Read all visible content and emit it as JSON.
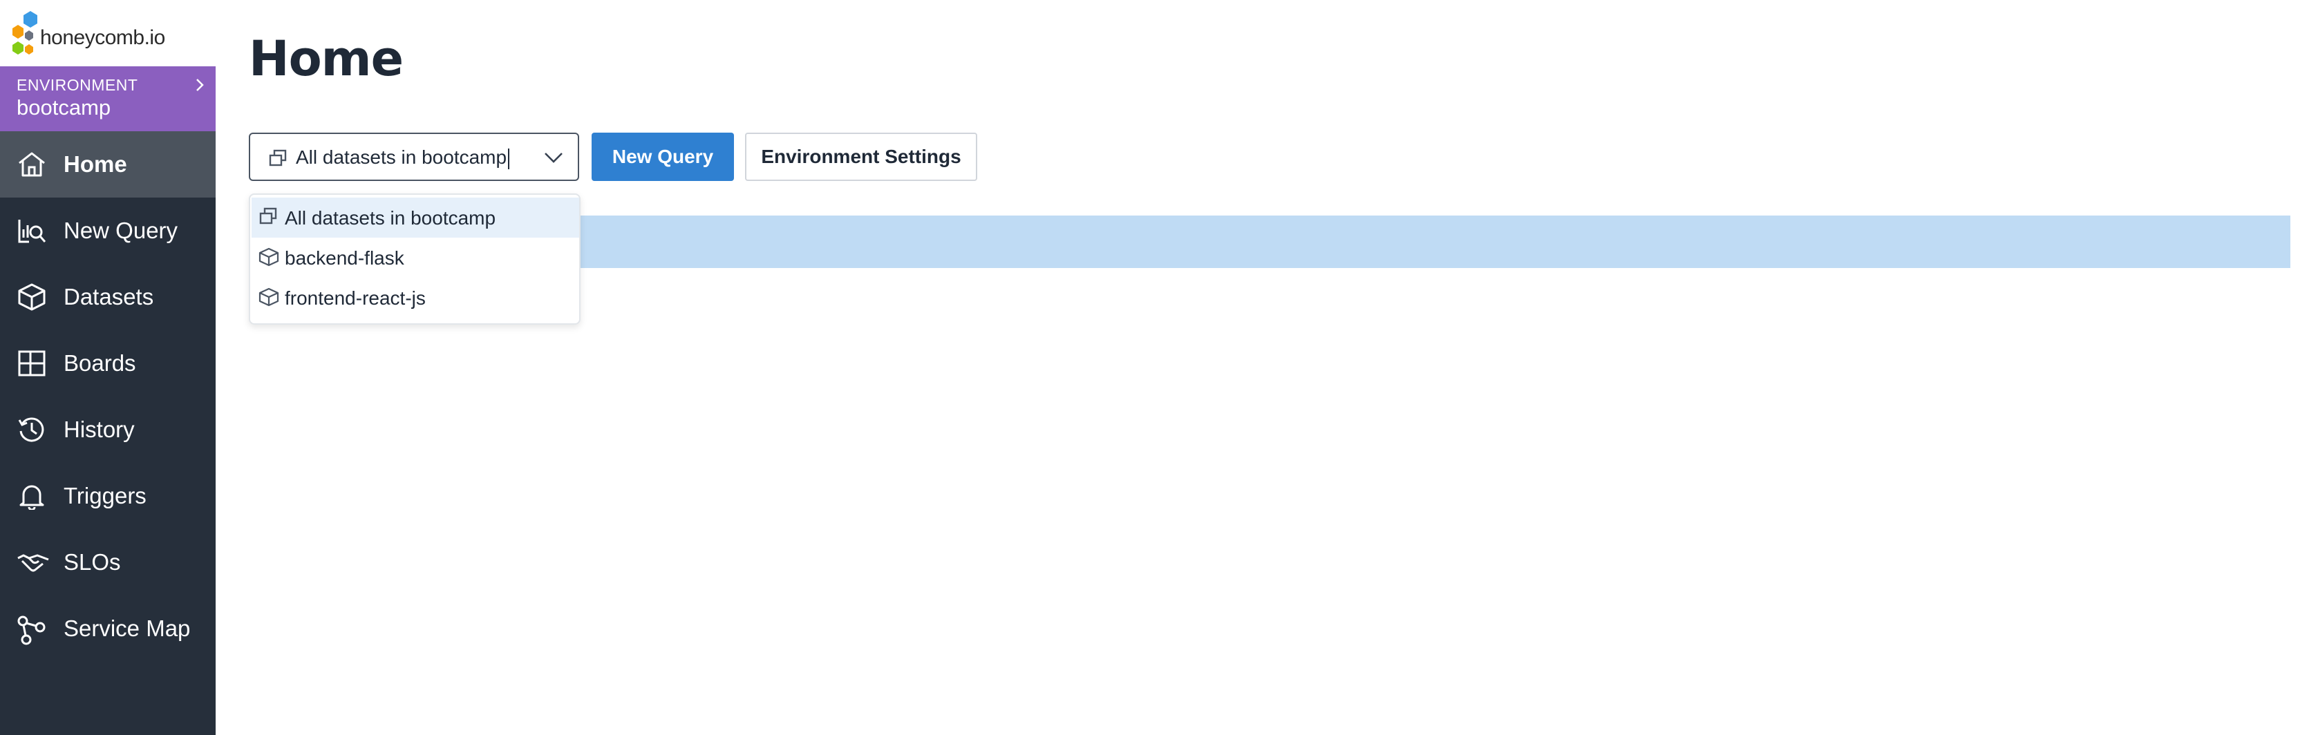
{
  "brand": {
    "logo_text": "honeycomb.io",
    "colors": {
      "sidebar": "#262f3b",
      "environment": "#8b5fbf",
      "primary": "#2f80d1"
    }
  },
  "environment": {
    "label": "ENVIRONMENT",
    "name": "bootcamp"
  },
  "sidebar": {
    "items": [
      {
        "label": "Home",
        "icon": "home-icon",
        "active": true
      },
      {
        "label": "New Query",
        "icon": "query-icon",
        "active": false
      },
      {
        "label": "Datasets",
        "icon": "cube-icon",
        "active": false
      },
      {
        "label": "Boards",
        "icon": "board-icon",
        "active": false
      },
      {
        "label": "History",
        "icon": "history-icon",
        "active": false
      },
      {
        "label": "Triggers",
        "icon": "bell-icon",
        "active": false
      },
      {
        "label": "SLOs",
        "icon": "handshake-icon",
        "active": false
      },
      {
        "label": "Service Map",
        "icon": "service-map-icon",
        "active": false
      }
    ]
  },
  "main": {
    "title": "Home",
    "dataset_select": {
      "value": "All datasets in bootcamp"
    },
    "new_query_label": "New Query",
    "env_settings_label": "Environment Settings",
    "dropdown": {
      "options": [
        {
          "label": "All datasets in bootcamp",
          "icon": "datasets-icon",
          "highlighted": true
        },
        {
          "label": "backend-flask",
          "icon": "dataset-cube-icon",
          "highlighted": false
        },
        {
          "label": "frontend-react-js",
          "icon": "dataset-cube-icon",
          "highlighted": false
        }
      ]
    }
  }
}
